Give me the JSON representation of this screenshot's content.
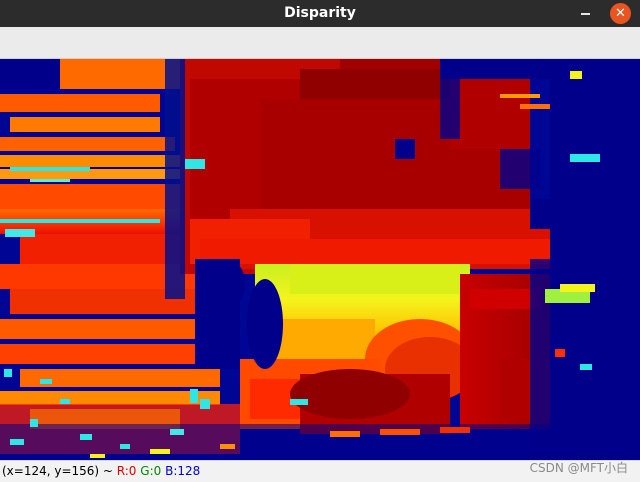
{
  "window": {
    "title": "Disparity",
    "close_glyph": "✕"
  },
  "image": {
    "description_colormap": "jet",
    "colors": {
      "deep_blue": "#00008b",
      "blue": "#0010c8",
      "cyan": "#2de6e6",
      "yellow": "#f4f41c",
      "orange": "#ff7a00",
      "red": "#f01800",
      "dark_red": "#a00000"
    }
  },
  "status": {
    "coords": "(x=124, y=156) ~ ",
    "r": "R:0",
    "g": "G:0",
    "b": "B:128"
  },
  "watermark": "CSDN @MFT小白"
}
